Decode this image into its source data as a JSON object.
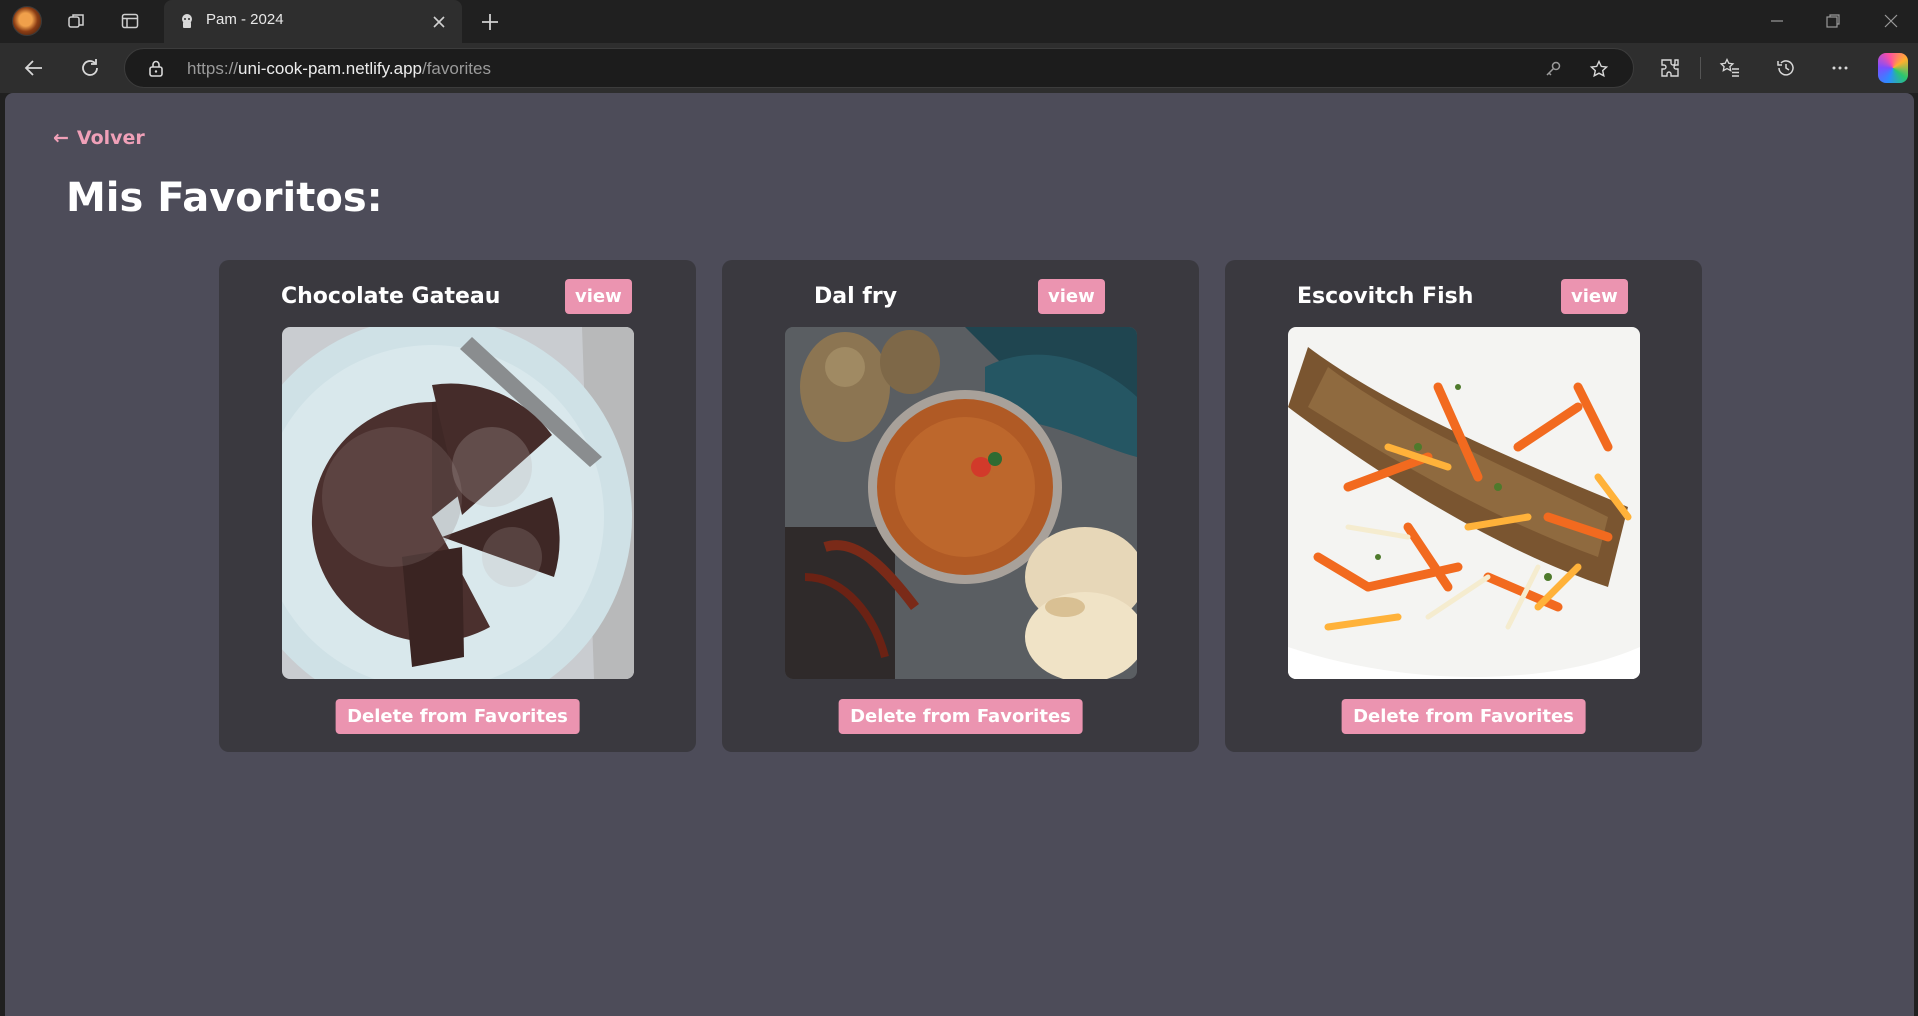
{
  "browser": {
    "tab_title": "Pam - 2024",
    "url_prefix": "https://",
    "url_host": "uni-cook-pam.netlify.app",
    "url_path": "/favorites"
  },
  "page": {
    "back_label": "Volver",
    "back_arrow": "←",
    "title": "Mis Favoritos:"
  },
  "favorites": [
    {
      "name": "Chocolate Gateau",
      "view_label": "view",
      "delete_label": "Delete from Favorites",
      "image": "chocolate-gateau-photo"
    },
    {
      "name": "Dal fry",
      "view_label": "view",
      "delete_label": "Delete from Favorites",
      "image": "dal-fry-photo"
    },
    {
      "name": "Escovitch Fish",
      "view_label": "view",
      "delete_label": "Delete from Favorites",
      "image": "escovitch-fish-photo"
    }
  ],
  "colors": {
    "accent": "#eb94b0",
    "page_bg": "#4d4c59",
    "card_bg": "#3a393f"
  }
}
